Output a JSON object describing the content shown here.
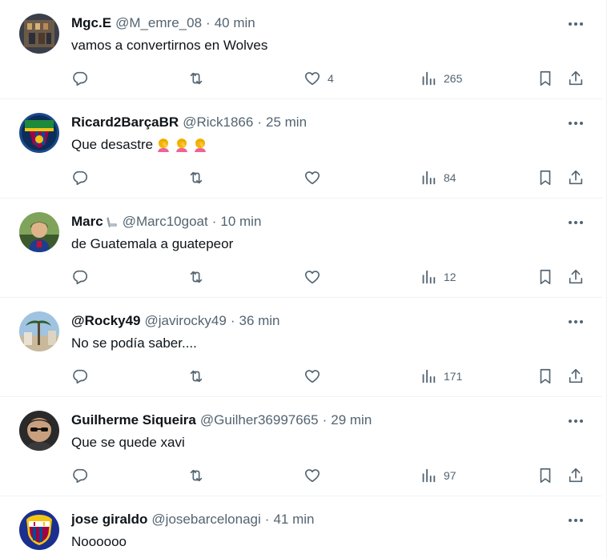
{
  "tweets": [
    {
      "name": "Mgc.E",
      "handle": "@M_emre_08",
      "separator": "·",
      "time": "40 min",
      "text": "vamos a convertirnos en Wolves",
      "emojis": [],
      "replies": "",
      "retweets": "",
      "likes": "4",
      "views": "265"
    },
    {
      "name": "Ricard2BarçaBR",
      "handle": "@Rick1866",
      "separator": "·",
      "time": "25 min",
      "text": "Que desastre",
      "emojis": [
        "person-facepalming",
        "person-facepalming",
        "person-facepalming"
      ],
      "replies": "",
      "retweets": "",
      "likes": "",
      "views": "84"
    },
    {
      "name": "Marc",
      "badge": "high-heel-icon",
      "handle": "@Marc10goat",
      "separator": "·",
      "time": "10 min",
      "text": "de Guatemala a guatepeor",
      "emojis": [],
      "replies": "",
      "retweets": "",
      "likes": "",
      "views": "12"
    },
    {
      "name": "@Rocky49",
      "handle": "@javirocky49",
      "separator": "·",
      "time": "36 min",
      "text": "No se podía saber....",
      "emojis": [],
      "replies": "",
      "retweets": "",
      "likes": "",
      "views": "171"
    },
    {
      "name": "Guilherme Siqueira",
      "handle": "@Guilher36997665",
      "separator": "·",
      "time": "29 min",
      "text": "Que se quede xavi",
      "emojis": [],
      "replies": "",
      "retweets": "",
      "likes": "",
      "views": "97"
    },
    {
      "name": "jose giraldo",
      "handle": "@josebarcelonagi",
      "separator": "·",
      "time": "41 min",
      "text": "Noooooo",
      "emojis": []
    }
  ],
  "colors": {
    "text_primary": "#0f1419",
    "text_secondary": "#536471",
    "divider": "#eff3f4",
    "barca_blue": "#004d98",
    "barca_red": "#a50044"
  },
  "icons": {
    "more": "more-horizontal-icon",
    "reply": "reply-icon",
    "retweet": "retweet-icon",
    "like": "heart-icon",
    "views": "views-chart-icon",
    "bookmark": "bookmark-icon",
    "share": "share-icon"
  }
}
